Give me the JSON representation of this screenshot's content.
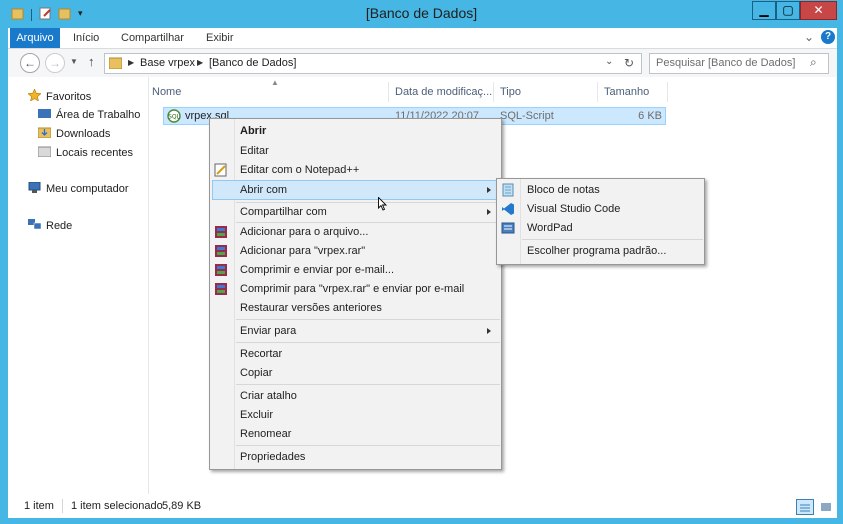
{
  "window": {
    "title": "[Banco de Dados]"
  },
  "ribbon": {
    "tabs": [
      "Arquivo",
      "Início",
      "Compartilhar",
      "Exibir"
    ]
  },
  "address": {
    "path": [
      "Base vrpex",
      "[Banco de Dados]"
    ],
    "search_placeholder": "Pesquisar [Banco de Dados]"
  },
  "nav": {
    "favorites": "Favoritos",
    "items": [
      "Área de Trabalho",
      "Downloads",
      "Locais recentes"
    ],
    "computer": "Meu computador",
    "network": "Rede"
  },
  "list": {
    "columns": [
      "Nome",
      "Data de modificaç...",
      "Tipo",
      "Tamanho"
    ],
    "rows": [
      {
        "name": "vrpex.sql",
        "date": "11/11/2022 20:07",
        "type": "SQL-Script",
        "size": "6 KB"
      }
    ]
  },
  "context_menu": {
    "items": [
      "Abrir",
      "Editar",
      "Editar com o Notepad++",
      "Abrir com",
      "Compartilhar com",
      "Adicionar para o arquivo...",
      "Adicionar para \"vrpex.rar\"",
      "Comprimir e enviar por e-mail...",
      "Comprimir para \"vrpex.rar\" e enviar por e-mail",
      "Restaurar versões anteriores",
      "Enviar para",
      "Recortar",
      "Copiar",
      "Criar atalho",
      "Excluir",
      "Renomear",
      "Propriedades"
    ]
  },
  "submenu": {
    "items": [
      "Bloco de notas",
      "Visual Studio Code",
      "WordPad",
      "Escolher programa padrão..."
    ]
  },
  "status": {
    "count": "1 item",
    "selected": "1 item selecionado",
    "size": "5,89 KB"
  },
  "colors": {
    "frame": "#46b6e4",
    "file_tab": "#1979ca",
    "selection": "#cce8ff",
    "menu_highlight": "#d1e8fa",
    "close_button": "#c74747"
  },
  "icons": {
    "folder": "folder-icon",
    "star": "star-icon",
    "rar": "winrar-icon",
    "vscode": "vscode-icon",
    "notepad": "notepad-icon"
  }
}
